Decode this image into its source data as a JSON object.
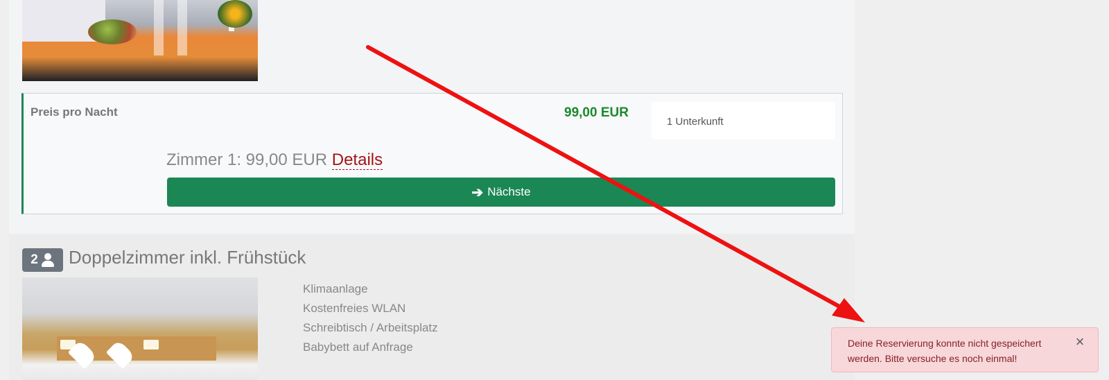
{
  "offer_1": {
    "price_label": "Preis pro Nacht",
    "price_value": "99,00 EUR",
    "units_select": "1 Unterkunft",
    "room_summary": "Zimmer 1: 99,00 EUR",
    "details_link": "Details",
    "next_button": "Nächste",
    "arrow_icon": "arrow-right-icon"
  },
  "offer_2": {
    "guest_count": "2",
    "guest_icon": "person-icon",
    "title": "Doppelzimmer inkl. Frühstück",
    "amenities": [
      "Klimaanlage",
      "Kostenfreies WLAN",
      "Schreibtisch / Arbeitsplatz",
      "Babybett auf Anfrage"
    ]
  },
  "alert": {
    "message": "Deine Reservierung konnte nicht gespeichert werden. Bitte versuche es noch einmal!",
    "close_symbol": "×"
  },
  "colors": {
    "primary_green": "#1b8754",
    "price_green": "#1a8a2a",
    "link_red": "#a11616",
    "alert_bg": "#f8d7da",
    "annotation_arrow": "#ee1111"
  }
}
